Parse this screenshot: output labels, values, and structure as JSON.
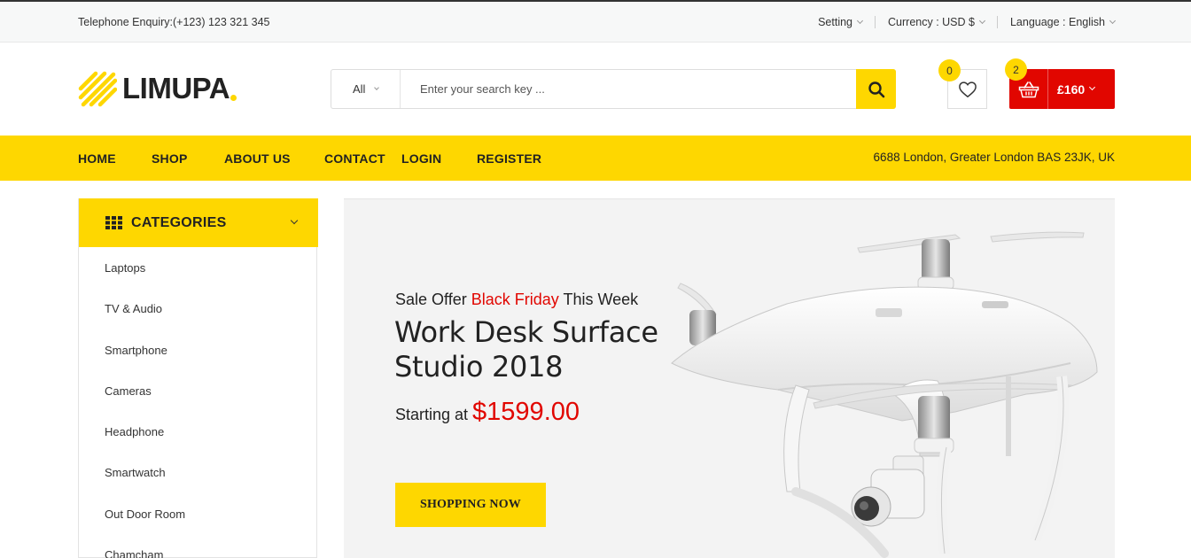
{
  "topbar": {
    "phone": "Telephone Enquiry:(+123) 123 321 345",
    "setting": "Setting",
    "currency": "Currency : USD $",
    "language": "Language : English"
  },
  "header": {
    "logo": "LIMUPA",
    "search": {
      "category": "All",
      "placeholder": "Enter your search key ..."
    },
    "wishlist_count": "0",
    "cart_count": "2",
    "cart_total": "£160"
  },
  "nav": {
    "items": [
      "HOME",
      "SHOP",
      "ABOUT US",
      "CONTACT",
      "LOGIN",
      "REGISTER"
    ],
    "address": "6688 London, Greater London BAS 23JK, UK"
  },
  "categories": {
    "title": "CATEGORIES",
    "items": [
      "Laptops",
      "TV & Audio",
      "Smartphone",
      "Cameras",
      "Headphone",
      "Smartwatch",
      "Out Door Room",
      "Chamcham"
    ]
  },
  "hero": {
    "pre_1": "Sale Offer",
    "pre_highlight": "Black Friday",
    "pre_2": "This Week",
    "title": "Work Desk Surface Studio 2018",
    "price_label": "Starting at",
    "price": "$1599.00",
    "cta": "SHOPPING NOW"
  },
  "colors": {
    "accent": "#fed700",
    "sale": "#e10600",
    "text": "#222222"
  },
  "icons": [
    "logo-stripes-icon",
    "chevron-down-icon",
    "search-icon",
    "heart-icon",
    "basket-icon",
    "grid-icon",
    "drone-image"
  ]
}
